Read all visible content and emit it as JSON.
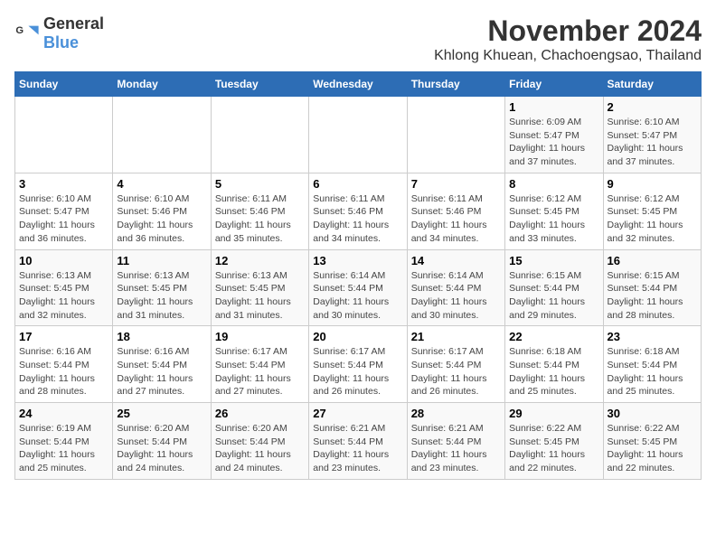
{
  "logo": {
    "text_general": "General",
    "text_blue": "Blue"
  },
  "title": {
    "month": "November 2024",
    "location": "Khlong Khuean, Chachoengsao, Thailand"
  },
  "weekdays": [
    "Sunday",
    "Monday",
    "Tuesday",
    "Wednesday",
    "Thursday",
    "Friday",
    "Saturday"
  ],
  "weeks": [
    [
      {
        "day": "",
        "info": ""
      },
      {
        "day": "",
        "info": ""
      },
      {
        "day": "",
        "info": ""
      },
      {
        "day": "",
        "info": ""
      },
      {
        "day": "",
        "info": ""
      },
      {
        "day": "1",
        "info": "Sunrise: 6:09 AM\nSunset: 5:47 PM\nDaylight: 11 hours and 37 minutes."
      },
      {
        "day": "2",
        "info": "Sunrise: 6:10 AM\nSunset: 5:47 PM\nDaylight: 11 hours and 37 minutes."
      }
    ],
    [
      {
        "day": "3",
        "info": "Sunrise: 6:10 AM\nSunset: 5:47 PM\nDaylight: 11 hours and 36 minutes."
      },
      {
        "day": "4",
        "info": "Sunrise: 6:10 AM\nSunset: 5:46 PM\nDaylight: 11 hours and 36 minutes."
      },
      {
        "day": "5",
        "info": "Sunrise: 6:11 AM\nSunset: 5:46 PM\nDaylight: 11 hours and 35 minutes."
      },
      {
        "day": "6",
        "info": "Sunrise: 6:11 AM\nSunset: 5:46 PM\nDaylight: 11 hours and 34 minutes."
      },
      {
        "day": "7",
        "info": "Sunrise: 6:11 AM\nSunset: 5:46 PM\nDaylight: 11 hours and 34 minutes."
      },
      {
        "day": "8",
        "info": "Sunrise: 6:12 AM\nSunset: 5:45 PM\nDaylight: 11 hours and 33 minutes."
      },
      {
        "day": "9",
        "info": "Sunrise: 6:12 AM\nSunset: 5:45 PM\nDaylight: 11 hours and 32 minutes."
      }
    ],
    [
      {
        "day": "10",
        "info": "Sunrise: 6:13 AM\nSunset: 5:45 PM\nDaylight: 11 hours and 32 minutes."
      },
      {
        "day": "11",
        "info": "Sunrise: 6:13 AM\nSunset: 5:45 PM\nDaylight: 11 hours and 31 minutes."
      },
      {
        "day": "12",
        "info": "Sunrise: 6:13 AM\nSunset: 5:45 PM\nDaylight: 11 hours and 31 minutes."
      },
      {
        "day": "13",
        "info": "Sunrise: 6:14 AM\nSunset: 5:44 PM\nDaylight: 11 hours and 30 minutes."
      },
      {
        "day": "14",
        "info": "Sunrise: 6:14 AM\nSunset: 5:44 PM\nDaylight: 11 hours and 30 minutes."
      },
      {
        "day": "15",
        "info": "Sunrise: 6:15 AM\nSunset: 5:44 PM\nDaylight: 11 hours and 29 minutes."
      },
      {
        "day": "16",
        "info": "Sunrise: 6:15 AM\nSunset: 5:44 PM\nDaylight: 11 hours and 28 minutes."
      }
    ],
    [
      {
        "day": "17",
        "info": "Sunrise: 6:16 AM\nSunset: 5:44 PM\nDaylight: 11 hours and 28 minutes."
      },
      {
        "day": "18",
        "info": "Sunrise: 6:16 AM\nSunset: 5:44 PM\nDaylight: 11 hours and 27 minutes."
      },
      {
        "day": "19",
        "info": "Sunrise: 6:17 AM\nSunset: 5:44 PM\nDaylight: 11 hours and 27 minutes."
      },
      {
        "day": "20",
        "info": "Sunrise: 6:17 AM\nSunset: 5:44 PM\nDaylight: 11 hours and 26 minutes."
      },
      {
        "day": "21",
        "info": "Sunrise: 6:17 AM\nSunset: 5:44 PM\nDaylight: 11 hours and 26 minutes."
      },
      {
        "day": "22",
        "info": "Sunrise: 6:18 AM\nSunset: 5:44 PM\nDaylight: 11 hours and 25 minutes."
      },
      {
        "day": "23",
        "info": "Sunrise: 6:18 AM\nSunset: 5:44 PM\nDaylight: 11 hours and 25 minutes."
      }
    ],
    [
      {
        "day": "24",
        "info": "Sunrise: 6:19 AM\nSunset: 5:44 PM\nDaylight: 11 hours and 25 minutes."
      },
      {
        "day": "25",
        "info": "Sunrise: 6:20 AM\nSunset: 5:44 PM\nDaylight: 11 hours and 24 minutes."
      },
      {
        "day": "26",
        "info": "Sunrise: 6:20 AM\nSunset: 5:44 PM\nDaylight: 11 hours and 24 minutes."
      },
      {
        "day": "27",
        "info": "Sunrise: 6:21 AM\nSunset: 5:44 PM\nDaylight: 11 hours and 23 minutes."
      },
      {
        "day": "28",
        "info": "Sunrise: 6:21 AM\nSunset: 5:44 PM\nDaylight: 11 hours and 23 minutes."
      },
      {
        "day": "29",
        "info": "Sunrise: 6:22 AM\nSunset: 5:45 PM\nDaylight: 11 hours and 22 minutes."
      },
      {
        "day": "30",
        "info": "Sunrise: 6:22 AM\nSunset: 5:45 PM\nDaylight: 11 hours and 22 minutes."
      }
    ]
  ]
}
